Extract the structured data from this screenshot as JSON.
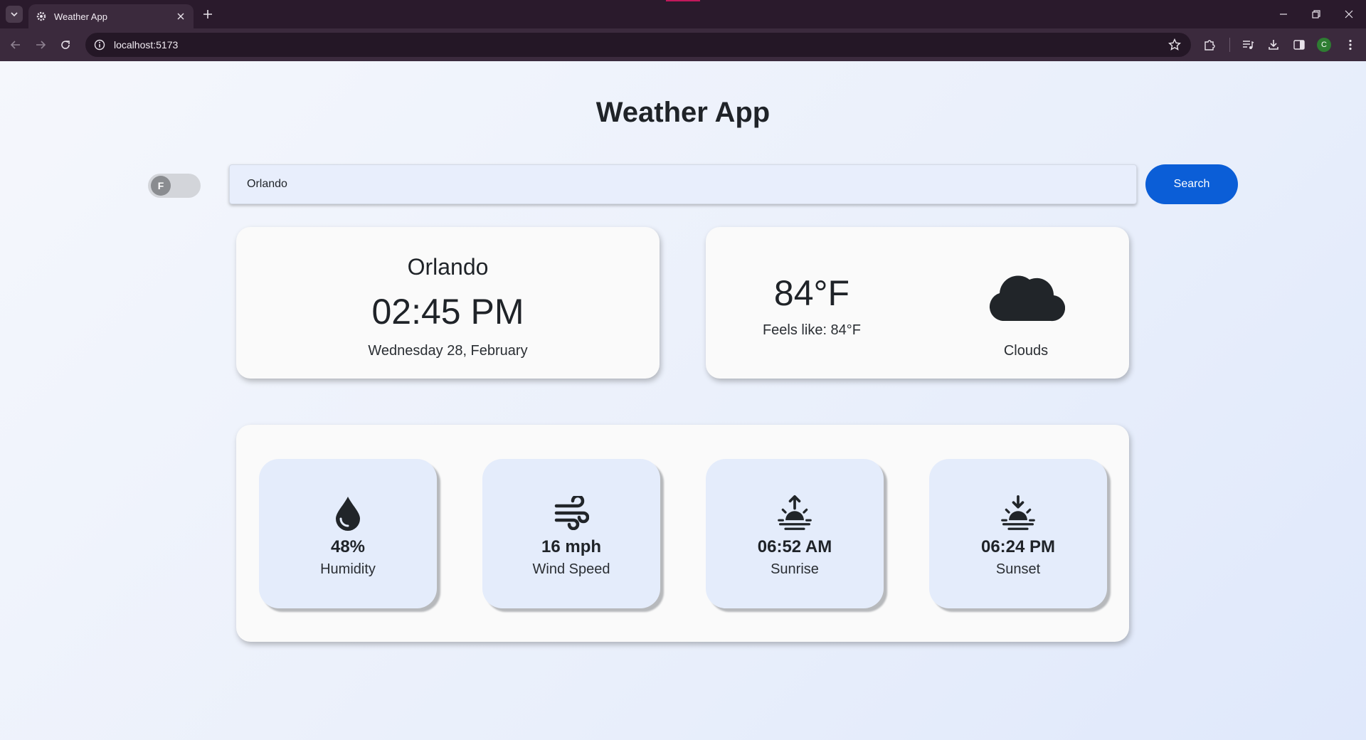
{
  "browser": {
    "tab_title": "Weather App",
    "url": "localhost:5173",
    "profile_initial": "C"
  },
  "app": {
    "title": "Weather App",
    "unit_toggle_label": "F",
    "search": {
      "value": "Orlando",
      "placeholder": "",
      "button_label": "Search"
    }
  },
  "location_card": {
    "city": "Orlando",
    "time": "02:45 PM",
    "date": "Wednesday 28, February"
  },
  "weather_card": {
    "temperature": "84°F",
    "feels_like": "Feels like: 84°F",
    "condition": "Clouds",
    "icon": "cloud-icon"
  },
  "details": [
    {
      "value": "48%",
      "label": "Humidity",
      "icon": "droplet-icon"
    },
    {
      "value": "16 mph",
      "label": "Wind Speed",
      "icon": "wind-icon"
    },
    {
      "value": "06:52 AM",
      "label": "Sunrise",
      "icon": "sunrise-icon"
    },
    {
      "value": "06:24 PM",
      "label": "Sunset",
      "icon": "sunset-icon"
    }
  ],
  "colors": {
    "primary_button": "#0b5ed7",
    "browser_frame": "#3b2a3d",
    "card_bg": "#fafafa",
    "stat_bg": "#e4ecfb"
  }
}
